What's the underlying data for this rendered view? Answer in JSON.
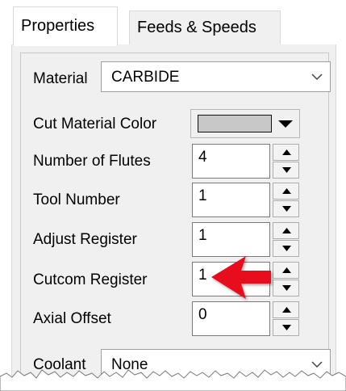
{
  "tabs": [
    {
      "label": "Properties",
      "active": true
    },
    {
      "label": "Feeds & Speeds",
      "active": false
    }
  ],
  "fields": {
    "material": {
      "label": "Material",
      "value": "CARBIDE"
    },
    "cut_material_color": {
      "label": "Cut Material Color",
      "color": "#c8c8c8"
    },
    "number_of_flutes": {
      "label": "Number of Flutes",
      "value": "4"
    },
    "tool_number": {
      "label": "Tool Number",
      "value": "1"
    },
    "adjust_register": {
      "label": "Adjust Register",
      "value": "1"
    },
    "cutcom_register": {
      "label": "Cutcom Register",
      "value": "1"
    },
    "axial_offset": {
      "label": "Axial Offset",
      "value": "0"
    },
    "coolant": {
      "label": "Coolant",
      "value": "None"
    }
  },
  "annotation": {
    "arrow_color": "#e8101a",
    "points_to": "cutcom_register"
  },
  "icons": {
    "dropdown": "chevron-down-icon",
    "spinner_up": "triangle-up-icon",
    "spinner_down": "triangle-down-icon",
    "color_dropdown": "caret-down-icon"
  }
}
